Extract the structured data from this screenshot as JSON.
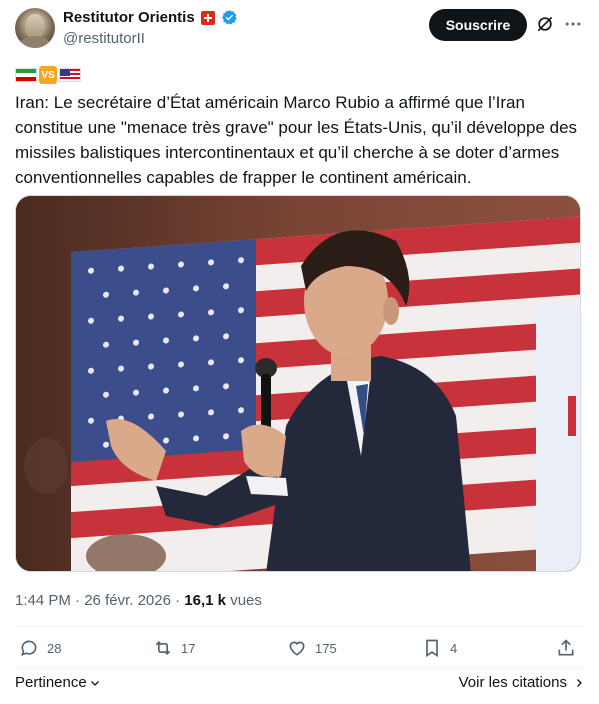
{
  "author": {
    "display_name": "Restitutor Orientis",
    "handle": "@restitutorII"
  },
  "follow_label": "Souscrire",
  "flags_vs": "VS",
  "tweet_text": "Iran: Le secrétaire d’État américain Marco Rubio a affirmé que l’Iran constitue une \"menace très grave\" pour les États-Unis, qu’il développe des missiles balistiques intercontinentaux et qu’il cherche à se doter d’armes conventionnelles capables de frapper le continent américain.",
  "meta": {
    "time": "1:44 PM",
    "separator": "·",
    "date": "26 févr. 2026",
    "views_count": "16,1 k",
    "views_label": "vues"
  },
  "actions": {
    "replies": "28",
    "reposts": "17",
    "likes": "175",
    "bookmarks": "4"
  },
  "footer": {
    "relevance_label": "Pertinence",
    "quotes_label": "Voir les citations"
  },
  "colors": {
    "verified_blue": "#1d9bf0",
    "swiss_red": "#da291c",
    "text_secondary": "#536471"
  }
}
